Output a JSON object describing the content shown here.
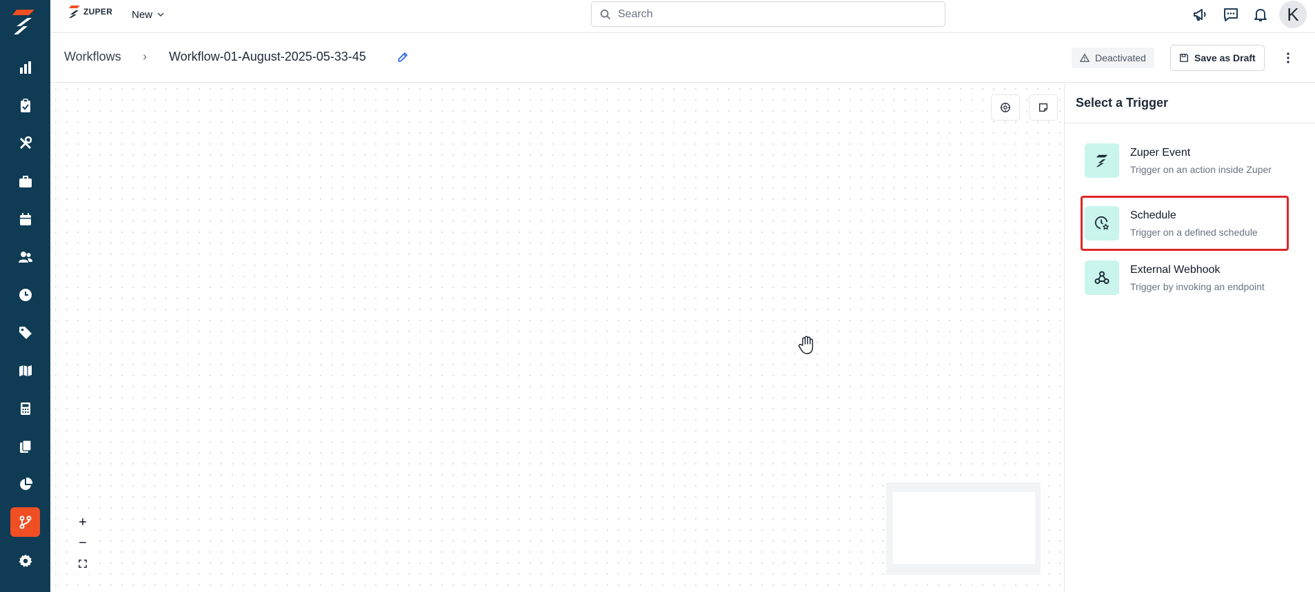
{
  "app": {
    "brand": "ZUPER",
    "new_label": "New",
    "search_placeholder": "Search",
    "avatar_initial": "K"
  },
  "sidebar": {
    "items": [
      {
        "name": "reports",
        "icon": "bar-chart-icon"
      },
      {
        "name": "jobs",
        "icon": "clipboard-icon"
      },
      {
        "name": "service",
        "icon": "tools-icon"
      },
      {
        "name": "projects",
        "icon": "briefcase-icon"
      },
      {
        "name": "schedule",
        "icon": "calendar-icon"
      },
      {
        "name": "users",
        "icon": "users-icon"
      },
      {
        "name": "timesheet",
        "icon": "clock-icon"
      },
      {
        "name": "pricing",
        "icon": "tag-icon"
      },
      {
        "name": "maps",
        "icon": "map-icon"
      },
      {
        "name": "estimates",
        "icon": "calculator-icon"
      },
      {
        "name": "documents",
        "icon": "documents-icon"
      },
      {
        "name": "analytics",
        "icon": "pie-chart-icon"
      },
      {
        "name": "workflows",
        "icon": "workflow-icon",
        "active": true
      },
      {
        "name": "settings",
        "icon": "gear-icon"
      }
    ],
    "accent": "#f04e23",
    "background": "#0f3b55"
  },
  "breadcrumb": {
    "root": "Workflows",
    "separator": "›",
    "title": "Workflow-01-August-2025-05-33-45"
  },
  "header_actions": {
    "status": "Deactivated",
    "save_draft": "Save as Draft"
  },
  "canvas": {
    "zoom_in": "+",
    "zoom_out": "−"
  },
  "panel": {
    "title": "Select a Trigger",
    "triggers": [
      {
        "name": "Zuper Event",
        "description": "Trigger on an action inside Zuper",
        "icon": "zuper-logo-icon"
      },
      {
        "name": "Schedule",
        "description": "Trigger on a defined schedule",
        "icon": "clock-star-icon",
        "selected": true
      },
      {
        "name": "External Webhook",
        "description": "Trigger by invoking an endpoint",
        "icon": "webhook-icon"
      }
    ],
    "highlight_color": "#dc2626",
    "icon_bg": "#c9f5ec"
  }
}
